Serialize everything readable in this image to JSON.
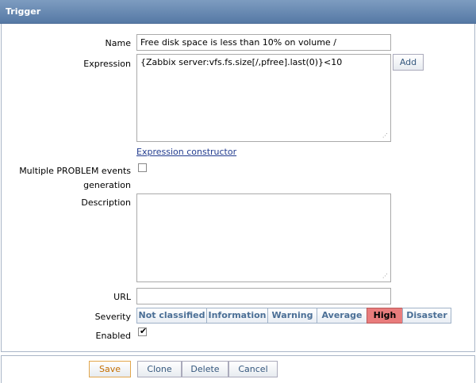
{
  "window": {
    "title": "Trigger"
  },
  "form": {
    "name_label": "Name",
    "name_value": "Free disk space is less than 10% on volume /",
    "expression_label": "Expression",
    "expression_value": "{Zabbix server:vfs.fs.size[/,pfree].last(0)}<10",
    "add_button": "Add",
    "expression_constructor_link": "Expression constructor",
    "multiple_problem_label_line1": "Multiple PROBLEM events",
    "multiple_problem_label_line2": "generation",
    "multiple_problem_checked": false,
    "description_label": "Description",
    "description_value": "",
    "url_label": "URL",
    "url_value": "",
    "severity_label": "Severity",
    "severity_options": [
      "Not classified",
      "Information",
      "Warning",
      "Average",
      "High",
      "Disaster"
    ],
    "severity_selected": "High",
    "enabled_label": "Enabled",
    "enabled_checked": true
  },
  "footer": {
    "save": "Save",
    "clone": "Clone",
    "delete": "Delete",
    "cancel": "Cancel"
  },
  "colors": {
    "titlebar": "#5679a5",
    "severity_high": "#e97c7c",
    "save_accent": "#e2a64c",
    "link": "#223c8f"
  }
}
